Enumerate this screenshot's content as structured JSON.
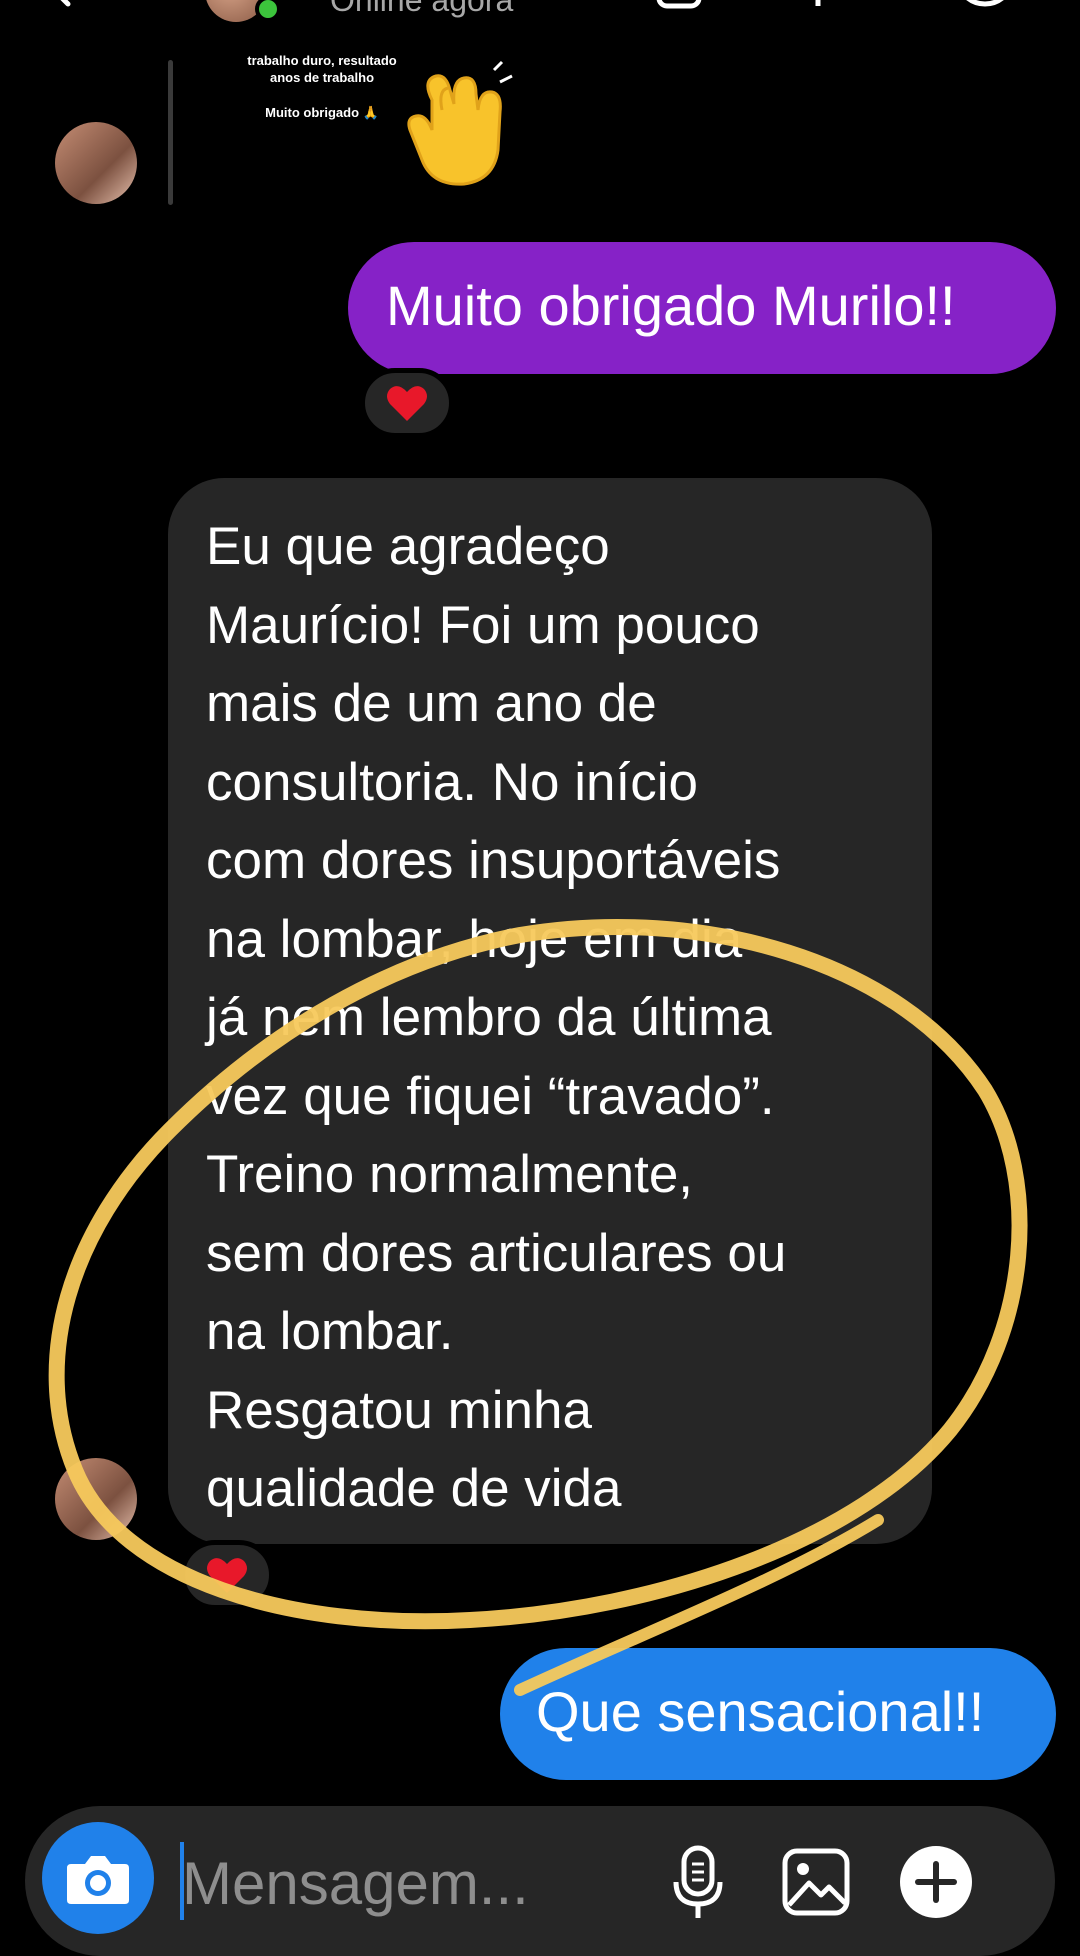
{
  "header": {
    "status": "Online agora"
  },
  "story": {
    "lines": [
      "trabalho duro, resultado",
      "anos de trabalho"
    ],
    "thanks": "Muito obrigado 🙏"
  },
  "messages": [
    {
      "id": "m1",
      "side": "right",
      "text": "Muito obrigado Murilo!!",
      "color": "#8622c7",
      "reaction": "heart"
    },
    {
      "id": "m2",
      "side": "left",
      "lines": [
        "Eu que agradeço",
        "Maurício! Foi um pouco",
        "mais de um ano de",
        "consultoria. No início",
        "com dores insuportáveis",
        "na lombar, hoje em dia",
        "já nem lembro da última",
        "vez que fiquei “travado”.",
        "Treino normalmente,",
        "sem dores articulares ou",
        "na lombar.",
        "Resgatou minha",
        "qualidade de vida"
      ],
      "color": "#262626",
      "reaction": "heart"
    },
    {
      "id": "m3",
      "side": "right",
      "text": "Que sensacional!!",
      "color": "#2081ea"
    }
  ],
  "composer": {
    "placeholder": "Mensagem..."
  },
  "colors": {
    "accent_blue": "#2081ea",
    "sent_purple": "#8622c7",
    "received_gray": "#262626",
    "highlight_yellow": "#f7c95c",
    "online_green": "#3cc43c"
  },
  "icons": [
    "back-icon",
    "camera-icon",
    "microphone-icon",
    "gallery-icon",
    "add-icon",
    "heart-icon",
    "clapping-hands-icon"
  ]
}
